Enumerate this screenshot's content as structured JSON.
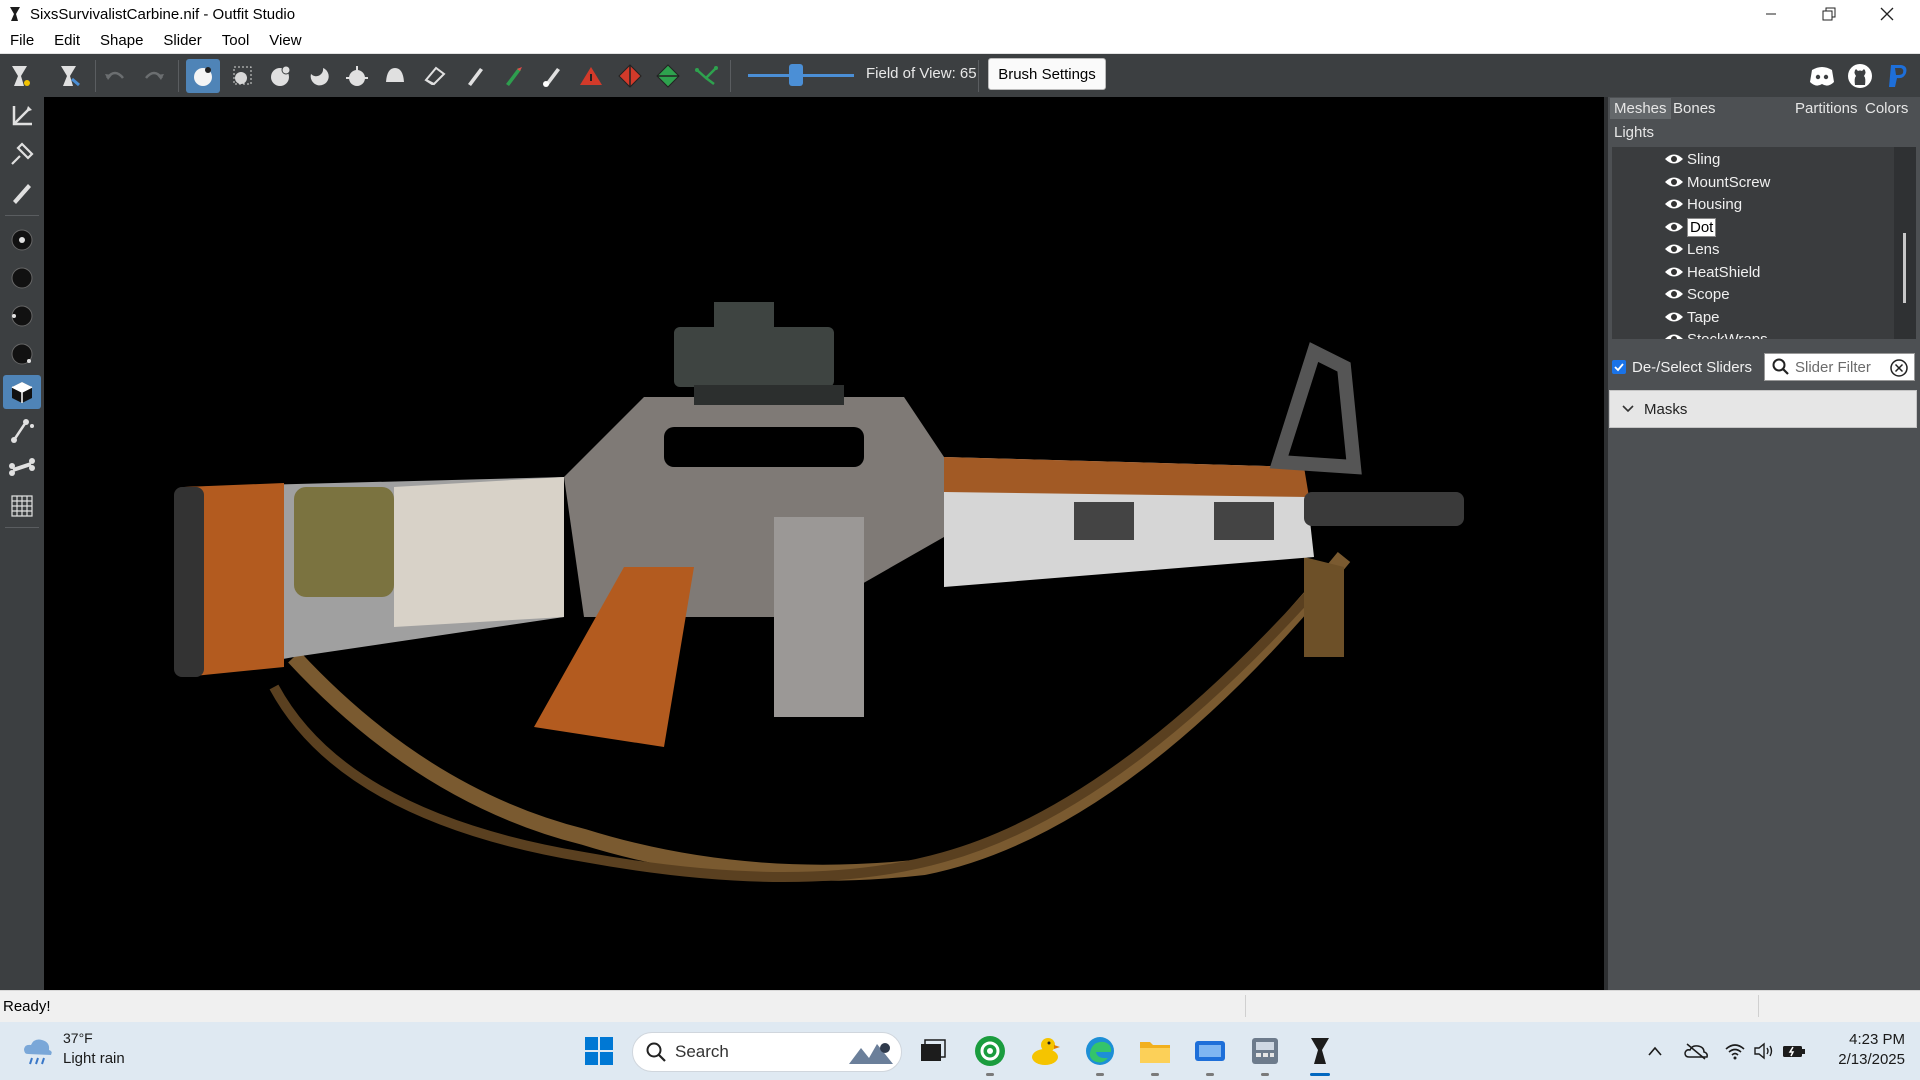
{
  "window": {
    "title": "SixsSurvivalistCarbine.nif - Outfit Studio",
    "controls": [
      "minimize",
      "restore",
      "close"
    ]
  },
  "menu": [
    "File",
    "Edit",
    "Shape",
    "Slider",
    "Tool",
    "View"
  ],
  "toolbar": {
    "fov_label": "Field of View: 65",
    "fov_value": 65,
    "brush_settings_label": "Brush Settings",
    "icons": [
      "app-logo-icon",
      "app-logo-alt-icon",
      "undo-icon",
      "redo-icon",
      "select-brush-icon",
      "mask-brush-icon",
      "inflate-brush-icon",
      "deflate-brush-icon",
      "move-brush-icon",
      "smooth-brush-icon",
      "eraser-icon",
      "weight-brush-icon",
      "color-brush-icon",
      "alpha-brush-icon",
      "collapse-vertex-icon",
      "flip-edge-icon",
      "split-edge-icon",
      "lasso-icon"
    ],
    "right_icons": [
      "discord-icon",
      "github-icon",
      "paypal-icon"
    ]
  },
  "left_tools": [
    "transform-icon",
    "pivot-icon",
    "pen-icon",
    "vertex-select-icon",
    "brush-size-small-icon",
    "brush-size-medium-icon",
    "brush-size-large-icon",
    "cube-view-icon",
    "bone-icon",
    "bone-transform-icon",
    "grid-icon"
  ],
  "panel": {
    "tabs": [
      "Meshes",
      "Bones",
      "Partitions",
      "Colors",
      "Lights"
    ],
    "active_tab": "Meshes",
    "meshes": [
      {
        "name": "Sling",
        "selected": false
      },
      {
        "name": "MountScrew",
        "selected": false
      },
      {
        "name": "Housing",
        "selected": false
      },
      {
        "name": "Dot",
        "selected": true
      },
      {
        "name": "Lens",
        "selected": false
      },
      {
        "name": "HeatShield",
        "selected": false
      },
      {
        "name": "Scope",
        "selected": false
      },
      {
        "name": "Tape",
        "selected": false
      },
      {
        "name": "StockWraps",
        "selected": false
      }
    ],
    "deselect_sliders_label": "De-/Select Sliders",
    "deselect_sliders_checked": true,
    "slider_filter_placeholder": "Slider Filter",
    "masks_label": "Masks"
  },
  "status": {
    "text": "Ready!"
  },
  "taskbar": {
    "weather_temp": "37°F",
    "weather_desc": "Light rain",
    "search_label": "Search",
    "time": "4:23 PM",
    "date": "2/13/2025",
    "accent": "#0067c0"
  }
}
